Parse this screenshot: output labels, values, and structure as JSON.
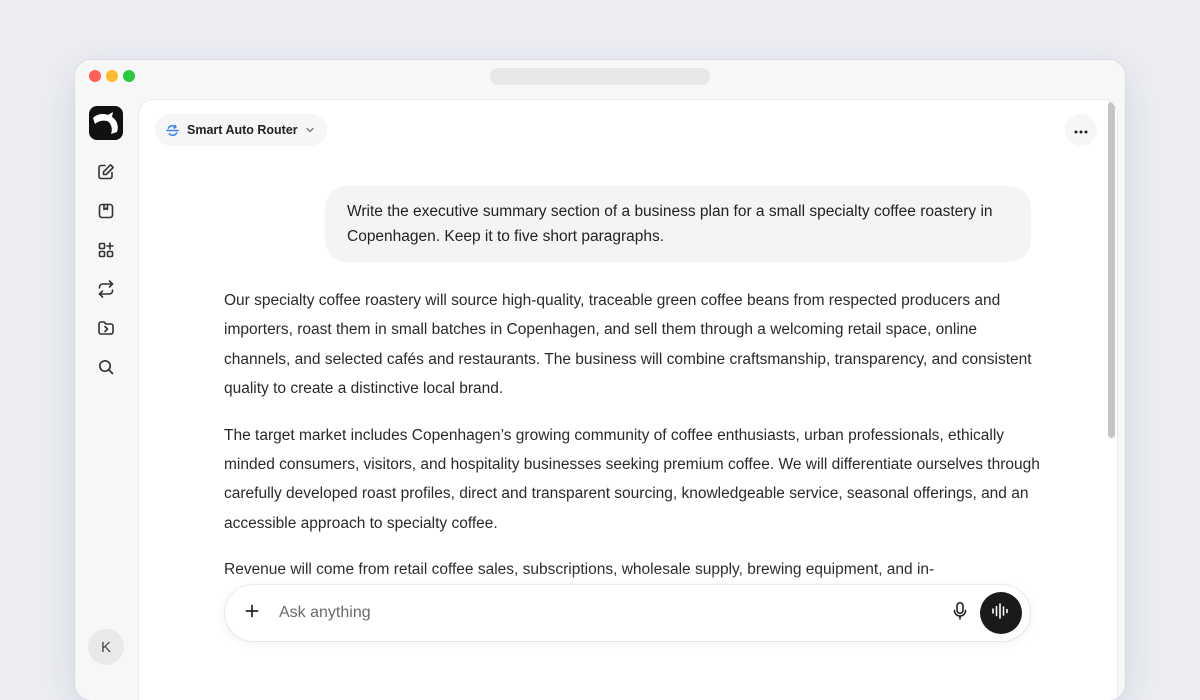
{
  "window": {
    "colors": {
      "close": "#ff5f57",
      "minimize": "#febc2e",
      "maximize": "#28c840"
    }
  },
  "sidebar": {
    "icons": [
      "new-chat-icon",
      "library-icon",
      "apps-icon",
      "swap-icon",
      "folder-icon",
      "search-icon"
    ],
    "avatar_initial": "K"
  },
  "header": {
    "model_selector_label": "Smart Auto Router",
    "accent_color": "#3b82f6"
  },
  "conversation": {
    "user_message": "Write the executive summary section of a business plan for a small specialty coffee roastery in Copenhagen. Keep it to five short paragraphs.",
    "assistant_paragraphs": [
      "Our specialty coffee roastery will source high-quality, traceable green coffee beans from respected producers and importers, roast them in small batches in Copenhagen, and sell them through a welcoming retail space, online channels, and selected cafés and restaurants. The business will combine craftsmanship, transparency, and consistent quality to create a distinctive local brand.",
      "The target market includes Copenhagen’s growing community of coffee enthusiasts, urban professionals, ethically minded consumers, visitors, and hospitality businesses seeking premium coffee. We will differentiate ourselves through carefully developed roast profiles, direct and transparent sourcing, knowledgeable service, seasonal offerings, and an accessible approach to specialty coffee.",
      "Revenue will come from retail coffee sales, subscriptions, wholesale supply, brewing equipment, and in-"
    ]
  },
  "composer": {
    "placeholder": "Ask anything"
  }
}
